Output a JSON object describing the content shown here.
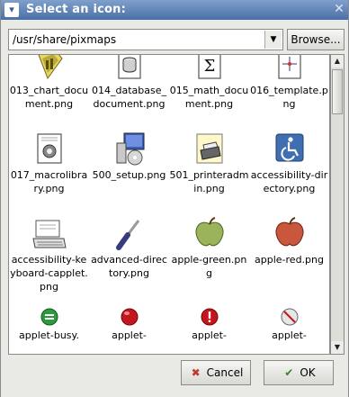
{
  "dialog": {
    "title": "Select an icon:",
    "menu_icon": "chevron-down-icon",
    "close_icon": "close-icon"
  },
  "path": {
    "value": "/usr/share/pixmaps",
    "browse_label": "Browse..."
  },
  "icons": [
    {
      "label": "013_chart_document.png",
      "icon": "chart-document-icon"
    },
    {
      "label": "014_database_document.png",
      "icon": "database-document-icon"
    },
    {
      "label": "015_math_document.png",
      "icon": "math-document-icon"
    },
    {
      "label": "016_template.png",
      "icon": "template-icon"
    },
    {
      "label": "017_macrolibrary.png",
      "icon": "macro-library-icon"
    },
    {
      "label": "500_setup.png",
      "icon": "setup-icon"
    },
    {
      "label": "501_printeradmin.png",
      "icon": "printer-admin-icon"
    },
    {
      "label": "accessibility-directory.png",
      "icon": "accessibility-icon"
    },
    {
      "label": "accessibility-keyboard-capplet.png",
      "icon": "keyboard-icon"
    },
    {
      "label": "advanced-directory.png",
      "icon": "screwdriver-icon"
    },
    {
      "label": "apple-green.png",
      "icon": "green-apple-icon"
    },
    {
      "label": "apple-red.png",
      "icon": "red-apple-icon"
    },
    {
      "label": "applet-busy.",
      "icon": "applet-busy-icon"
    },
    {
      "label": "applet-",
      "icon": "applet-red-dot-icon"
    },
    {
      "label": "applet-",
      "icon": "applet-error-icon"
    },
    {
      "label": "applet-",
      "icon": "applet-stop-icon"
    }
  ],
  "buttons": {
    "cancel_label": "Cancel",
    "ok_label": "OK"
  },
  "colors": {
    "titlebar": "#4a6fa5",
    "cancel_icon": "#c0392b",
    "ok_icon": "#3f7f2f"
  }
}
